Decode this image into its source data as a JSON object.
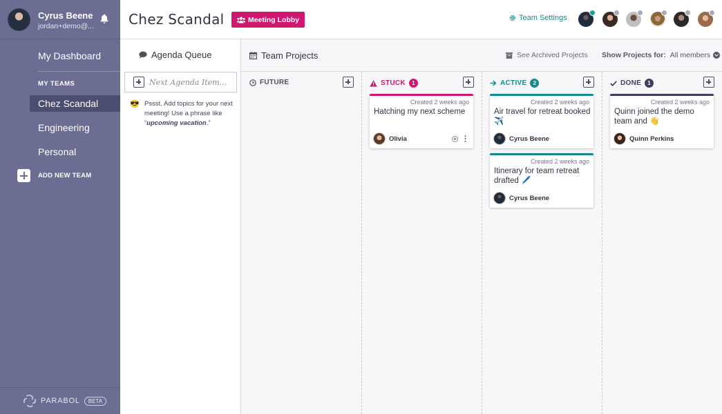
{
  "user": {
    "name": "Cyrus Beene",
    "email": "jordan+demo@..."
  },
  "nav": {
    "dashboard": "My Dashboard",
    "my_teams_label": "MY TEAMS",
    "teams": [
      "Chez Scandal",
      "Engineering",
      "Personal"
    ],
    "add_team": "ADD NEW TEAM"
  },
  "footer": {
    "brand": "PARABOL",
    "beta": "BETA"
  },
  "header": {
    "team_name": "Chez Scandal",
    "lobby_button": "Meeting Lobby",
    "team_settings": "Team Settings"
  },
  "agenda": {
    "title": "Agenda Queue",
    "input_placeholder": "Next Agenda Item...",
    "tip_text": "Pssst. Add topics for your next meeting! Use a phrase like",
    "tip_phrase": "upcoming vacation",
    "tip_emoji": "😎"
  },
  "projects": {
    "title": "Team Projects",
    "archived": "See Archived Projects",
    "show_for_label": "Show Projects for:",
    "show_for_value": "All members"
  },
  "columns": {
    "future": {
      "label": "FUTURE"
    },
    "stuck": {
      "label": "STUCK",
      "count": "1"
    },
    "active": {
      "label": "ACTIVE",
      "count": "2"
    },
    "done": {
      "label": "DONE",
      "count": "1"
    }
  },
  "cards": {
    "stuck_1": {
      "created": "Created 2 weeks ago",
      "text": "Hatching my next scheme",
      "owner": "Olivia"
    },
    "active_1": {
      "created": "Created 2 weeks ago",
      "text": "Air travel for retreat booked ✈️",
      "owner": "Cyrus Beene"
    },
    "active_2": {
      "created": "Created 2 weeks ago",
      "text": "Itinerary for team retreat drafted 🖊️",
      "owner": "Cyrus Beene"
    },
    "done_1": {
      "created": "Created 2 weeks ago",
      "text": "Quinn joined the demo team and 👋",
      "owner": "Quinn Perkins"
    }
  },
  "colors": {
    "sidebar": "#6b6d93",
    "active_team": "#4c4e70",
    "brand_pink": "#d01770",
    "teal": "#138a8c",
    "stuck": "#d01770",
    "active": "#138a8c",
    "done": "#3d3f5e"
  }
}
